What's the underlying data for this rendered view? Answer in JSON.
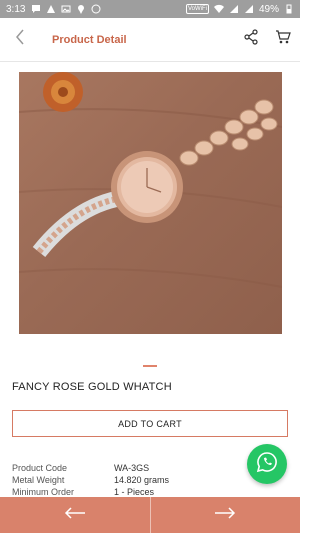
{
  "status_bar": {
    "time": "3:13",
    "battery": "49%",
    "network_label": "VoWiFi"
  },
  "header": {
    "title": "Product Detail"
  },
  "product": {
    "name": "FANCY ROSE GOLD WHATCH",
    "add_to_cart_label": "ADD TO CART",
    "carousel": {
      "slide_count": 1,
      "active_index": 0
    },
    "details": [
      {
        "label": "Product Code",
        "value": "WA-3GS"
      },
      {
        "label": "Metal Weight",
        "value": "14.820 grams"
      },
      {
        "label": "Minimum Order",
        "value": "1 - Pieces"
      }
    ]
  },
  "colors": {
    "accent": "#c8664a",
    "bottom_bar": "#d9826b",
    "whatsapp": "#25c665",
    "status_bar": "#9e9e9e"
  },
  "icons": {
    "back": "chevron-left-icon",
    "share": "share-icon",
    "cart": "cart-icon",
    "prev": "arrow-left-icon",
    "next": "arrow-right-icon",
    "fab": "whatsapp-icon"
  }
}
